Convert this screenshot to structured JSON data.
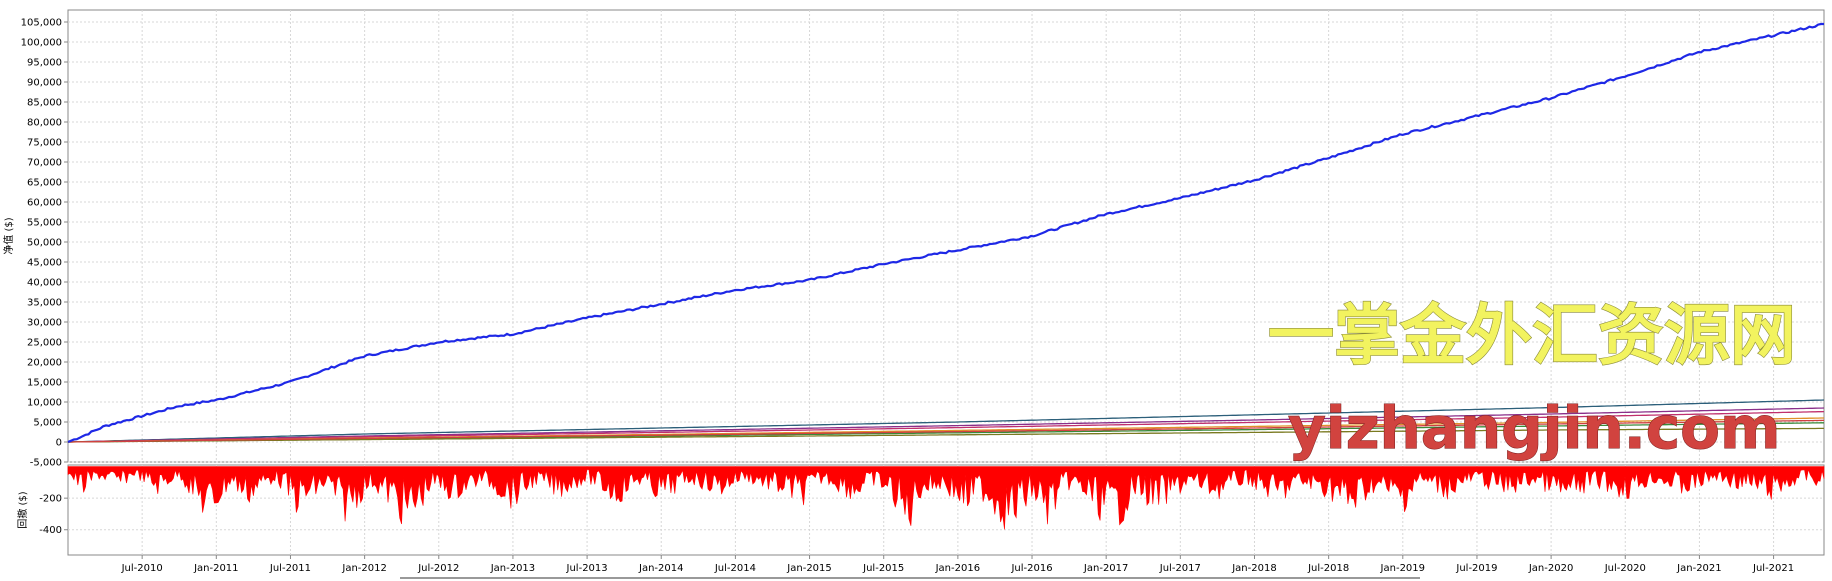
{
  "chart_data": [
    {
      "type": "line",
      "ylabel": "净值 ($)",
      "ylim": [
        -5000,
        108000
      ],
      "yticks": [
        -5000,
        0,
        5000,
        10000,
        15000,
        20000,
        25000,
        30000,
        35000,
        40000,
        45000,
        50000,
        55000,
        60000,
        65000,
        70000,
        75000,
        80000,
        85000,
        90000,
        95000,
        100000,
        105000
      ],
      "ytick_labels": [
        "-5,000",
        "0",
        "5,000",
        "10,000",
        "15,000",
        "20,000",
        "25,000",
        "30,000",
        "35,000",
        "40,000",
        "45,000",
        "50,000",
        "55,000",
        "60,000",
        "65,000",
        "70,000",
        "75,000",
        "80,000",
        "85,000",
        "90,000",
        "95,000",
        "100,000",
        "105,000"
      ],
      "xlim": [
        2010.0,
        2021.84
      ],
      "xticks": [
        2010.5,
        2011.0,
        2011.5,
        2012.0,
        2012.5,
        2013.0,
        2013.5,
        2014.0,
        2014.5,
        2015.0,
        2015.5,
        2016.0,
        2016.5,
        2017.0,
        2017.5,
        2018.0,
        2018.5,
        2019.0,
        2019.5,
        2020.0,
        2020.5,
        2021.0,
        2021.5
      ],
      "xtick_labels": [
        "Jul-2010",
        "Jan-2011",
        "Jul-2011",
        "Jan-2012",
        "Jul-2012",
        "Jan-2013",
        "Jul-2013",
        "Jan-2014",
        "Jul-2014",
        "Jan-2015",
        "Jul-2015",
        "Jan-2016",
        "Jul-2016",
        "Jan-2017",
        "Jul-2017",
        "Jan-2018",
        "Jul-2018",
        "Jan-2019",
        "Jul-2019",
        "Jan-2020",
        "Jul-2020",
        "Jan-2021",
        "Jul-2021"
      ],
      "grid": true,
      "series": [
        {
          "color": "#1e28e6",
          "x": [
            2010.0,
            2010.1,
            2010.25,
            2010.5,
            2010.75,
            2011.0,
            2011.5,
            2012.0,
            2012.5,
            2013.0,
            2013.5,
            2014.0,
            2014.5,
            2015.0,
            2015.5,
            2016.0,
            2016.5,
            2017.0,
            2017.5,
            2018.0,
            2018.5,
            2019.0,
            2019.5,
            2020.0,
            2020.5,
            2021.0,
            2021.84
          ],
          "values": [
            0,
            1500,
            4000,
            6500,
            9000,
            10500,
            15000,
            21500,
            25000,
            27000,
            31000,
            34500,
            38000,
            40500,
            44500,
            48000,
            51500,
            57000,
            61000,
            65500,
            71000,
            77000,
            81500,
            86000,
            91500,
            97500,
            104500
          ]
        },
        {
          "color": "#2c5f7a",
          "x": [
            2010.0,
            2012.0,
            2014.0,
            2016.0,
            2018.0,
            2020.0,
            2021.84
          ],
          "values": [
            0,
            2000,
            3500,
            5000,
            6800,
            8600,
            10500
          ]
        },
        {
          "color": "#8a2f8a",
          "x": [
            2010.0,
            2012.0,
            2014.0,
            2016.0,
            2018.0,
            2020.0,
            2021.84
          ],
          "values": [
            0,
            1500,
            2800,
            4100,
            5500,
            7000,
            8500
          ]
        },
        {
          "color": "#c0306e",
          "x": [
            2010.0,
            2012.0,
            2014.0,
            2016.0,
            2018.0,
            2020.0,
            2021.84
          ],
          "values": [
            0,
            1300,
            2400,
            3600,
            4900,
            6200,
            7600
          ]
        },
        {
          "color": "#e0902a",
          "x": [
            2010.0,
            2012.0,
            2014.0,
            2016.0,
            2018.0,
            2020.0,
            2021.84
          ],
          "values": [
            0,
            1000,
            1900,
            2900,
            3900,
            4900,
            6000
          ]
        },
        {
          "color": "#3a8a3a",
          "x": [
            2010.0,
            2012.0,
            2014.0,
            2016.0,
            2018.0,
            2020.0,
            2021.84
          ],
          "values": [
            0,
            800,
            1500,
            2300,
            3100,
            4000,
            4800
          ]
        },
        {
          "color": "#7a7a20",
          "x": [
            2010.0,
            2012.0,
            2014.0,
            2016.0,
            2018.0,
            2020.0,
            2021.84
          ],
          "values": [
            0,
            600,
            1200,
            1800,
            2400,
            3000,
            3400
          ]
        },
        {
          "color": "#d04040",
          "x": [
            2010.0,
            2012.0,
            2014.0,
            2016.0,
            2018.0,
            2020.0,
            2021.84
          ],
          "values": [
            0,
            900,
            1700,
            2600,
            3500,
            4500,
            5400
          ]
        }
      ]
    },
    {
      "type": "area",
      "ylabel": "回撤 ($)",
      "ylim": [
        -560,
        10
      ],
      "yticks": [
        -200,
        -400
      ],
      "ytick_labels": [
        "-200",
        "-400"
      ],
      "color": "#ff0000",
      "x": [
        2010.0,
        2010.1,
        2010.2,
        2010.35,
        2010.45,
        2010.6,
        2010.75,
        2010.95,
        2011.1,
        2011.2,
        2011.4,
        2011.55,
        2011.75,
        2011.85,
        2012.05,
        2012.2,
        2012.3,
        2012.45,
        2012.6,
        2012.8,
        2013.0,
        2013.15,
        2013.3,
        2013.5,
        2013.7,
        2013.85,
        2014.0,
        2014.2,
        2014.4,
        2014.55,
        2014.75,
        2014.95,
        2015.1,
        2015.3,
        2015.45,
        2015.6,
        2015.65,
        2015.75,
        2015.9,
        2016.05,
        2016.15,
        2016.35,
        2016.5,
        2016.6,
        2016.75,
        2016.9,
        2017.05,
        2017.2,
        2017.35,
        2017.55,
        2017.75,
        2017.95,
        2018.15,
        2018.3,
        2018.5,
        2018.65,
        2018.8,
        2019.0,
        2019.1,
        2019.3,
        2019.5,
        2019.7,
        2019.9,
        2020.1,
        2020.3,
        2020.5,
        2020.7,
        2020.9,
        2021.1,
        2021.3,
        2021.5,
        2021.7,
        2021.84
      ],
      "values": [
        -60,
        -200,
        -80,
        -150,
        -60,
        -190,
        -70,
        -400,
        -120,
        -260,
        -90,
        -320,
        -150,
        -380,
        -140,
        -300,
        -450,
        -150,
        -230,
        -110,
        -280,
        -120,
        -210,
        -100,
        -260,
        -120,
        -240,
        -110,
        -200,
        -90,
        -170,
        -260,
        -100,
        -230,
        -120,
        -300,
        -500,
        -200,
        -150,
        -320,
        -200,
        -450,
        -220,
        -400,
        -150,
        -280,
        -460,
        -200,
        -300,
        -140,
        -220,
        -110,
        -260,
        -150,
        -200,
        -350,
        -170,
        -310,
        -130,
        -210,
        -110,
        -200,
        -120,
        -260,
        -130,
        -220,
        -110,
        -200,
        -100,
        -160,
        -230,
        -90,
        -160
      ]
    }
  ],
  "watermark": {
    "line1": "一掌金外汇资源网",
    "line2": "yizhangjin.com"
  }
}
